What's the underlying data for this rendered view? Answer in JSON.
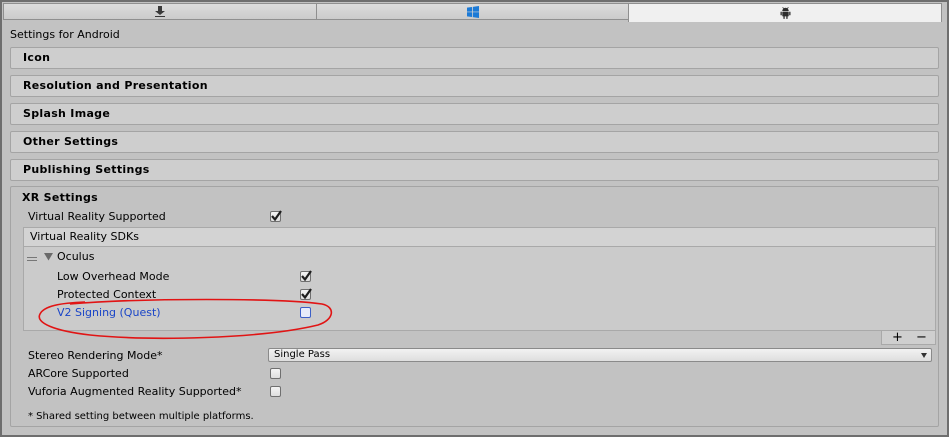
{
  "tabs": [
    {
      "name": "standalone",
      "icon": "download-arrow-icon",
      "active": false
    },
    {
      "name": "windows",
      "icon": "windows-logo-icon",
      "active": false
    },
    {
      "name": "android",
      "icon": "android-icon",
      "active": true
    }
  ],
  "page_title": "Settings for Android",
  "sections": [
    "Icon",
    "Resolution and Presentation",
    "Splash Image",
    "Other Settings",
    "Publishing Settings"
  ],
  "xr": {
    "title": "XR Settings",
    "vr_supported_label": "Virtual Reality Supported",
    "vr_supported_checked": true,
    "sdks_header": "Virtual Reality SDKs",
    "oculus": {
      "name": "Oculus",
      "low_overhead_label": "Low Overhead Mode",
      "low_overhead_checked": true,
      "protected_context_label": "Protected Context",
      "protected_context_checked": true,
      "v2_signing_label": "V2 Signing (Quest)",
      "v2_signing_checked": false
    },
    "add_symbol": "+",
    "remove_symbol": "−",
    "stereo_label": "Stereo Rendering Mode*",
    "stereo_value": "Single Pass",
    "arcore_label": "ARCore Supported",
    "arcore_checked": false,
    "vuforia_label": "Vuforia Augmented Reality Supported*",
    "vuforia_checked": false,
    "footnote": "* Shared setting between multiple platforms."
  },
  "colors": {
    "highlight_label": "#1a45c8",
    "annotation_circle": "#e11414"
  }
}
